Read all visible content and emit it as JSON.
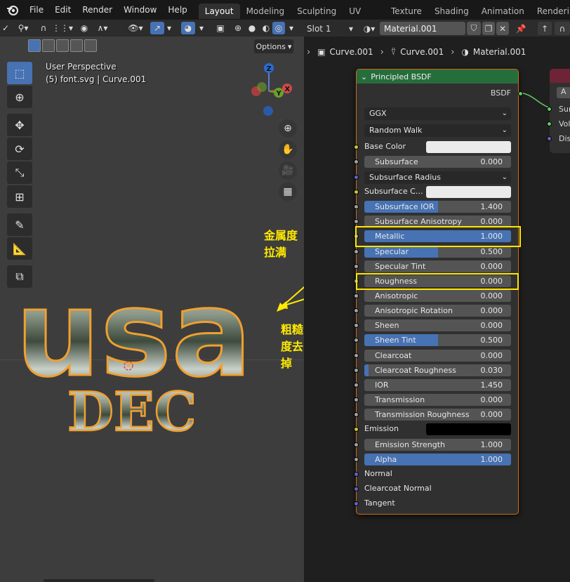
{
  "menu": {
    "items": [
      "File",
      "Edit",
      "Render",
      "Window",
      "Help"
    ],
    "workspaces": [
      "Layout",
      "Modeling",
      "Sculpting",
      "UV Editing",
      "Texture Paint",
      "Shading",
      "Animation",
      "Rendering"
    ],
    "active_workspace": "Layout"
  },
  "viewport": {
    "options_label": "Options",
    "info_line1": "User Perspective",
    "info_line2": "(5) font.svg | Curve.001",
    "gizmo": {
      "z": "Z",
      "y": "Y",
      "x": "X"
    },
    "text_top": "usa",
    "text_bottom": "DEC"
  },
  "annotations": {
    "metallic_note": "金属度拉满",
    "roughness_note": "粗糙度去掉"
  },
  "node_editor": {
    "slot": "Slot 1",
    "material": "Material.001",
    "breadcrumb": [
      "Curve.001",
      "Curve.001",
      "Material.001"
    ],
    "node_title": "Principled BSDF",
    "output_label": "BSDF",
    "distribution": "GGX",
    "subsurface_method": "Random Walk",
    "output_node_sockets": [
      "Sur",
      "Vol",
      "Dis"
    ],
    "output_node_field": "A",
    "inputs": {
      "base_color": "Base Color",
      "subsurface": {
        "label": "Subsurface",
        "value": "0.000"
      },
      "subsurface_radius": "Subsurface Radius",
      "subsurface_color": "Subsurface Co...",
      "subsurface_ior": {
        "label": "Subsurface IOR",
        "value": "1.400",
        "fill": 0.5
      },
      "subsurface_anisotropy": {
        "label": "Subsurface Anisotropy",
        "value": "0.000"
      },
      "metallic": {
        "label": "Metallic",
        "value": "1.000",
        "fill": 1.0
      },
      "specular": {
        "label": "Specular",
        "value": "0.500",
        "fill": 0.5
      },
      "specular_tint": {
        "label": "Specular Tint",
        "value": "0.000"
      },
      "roughness": {
        "label": "Roughness",
        "value": "0.000"
      },
      "anisotropic": {
        "label": "Anisotropic",
        "value": "0.000"
      },
      "anisotropic_rotation": {
        "label": "Anisotropic Rotation",
        "value": "0.000"
      },
      "sheen": {
        "label": "Sheen",
        "value": "0.000"
      },
      "sheen_tint": {
        "label": "Sheen Tint",
        "value": "0.500",
        "fill": 0.5
      },
      "clearcoat": {
        "label": "Clearcoat",
        "value": "0.000"
      },
      "clearcoat_roughness": {
        "label": "Clearcoat Roughness",
        "value": "0.030",
        "fill": 0.03
      },
      "ior": {
        "label": "IOR",
        "value": "1.450"
      },
      "transmission": {
        "label": "Transmission",
        "value": "0.000"
      },
      "transmission_roughness": {
        "label": "Transmission Roughness",
        "value": "0.000"
      },
      "emission": "Emission",
      "emission_strength": {
        "label": "Emission Strength",
        "value": "1.000"
      },
      "alpha": {
        "label": "Alpha",
        "value": "1.000",
        "fill": 1.0
      },
      "normal": "Normal",
      "clearcoat_normal": "Clearcoat Normal",
      "tangent": "Tangent"
    }
  },
  "colors": {
    "accent_blue": "#4772b3",
    "node_header_green": "#266d3c",
    "selection_orange": "#d06b16",
    "annotation_yellow": "#ffea00",
    "base_color_swatch": "#ebebeb",
    "emission_swatch": "#000000"
  }
}
